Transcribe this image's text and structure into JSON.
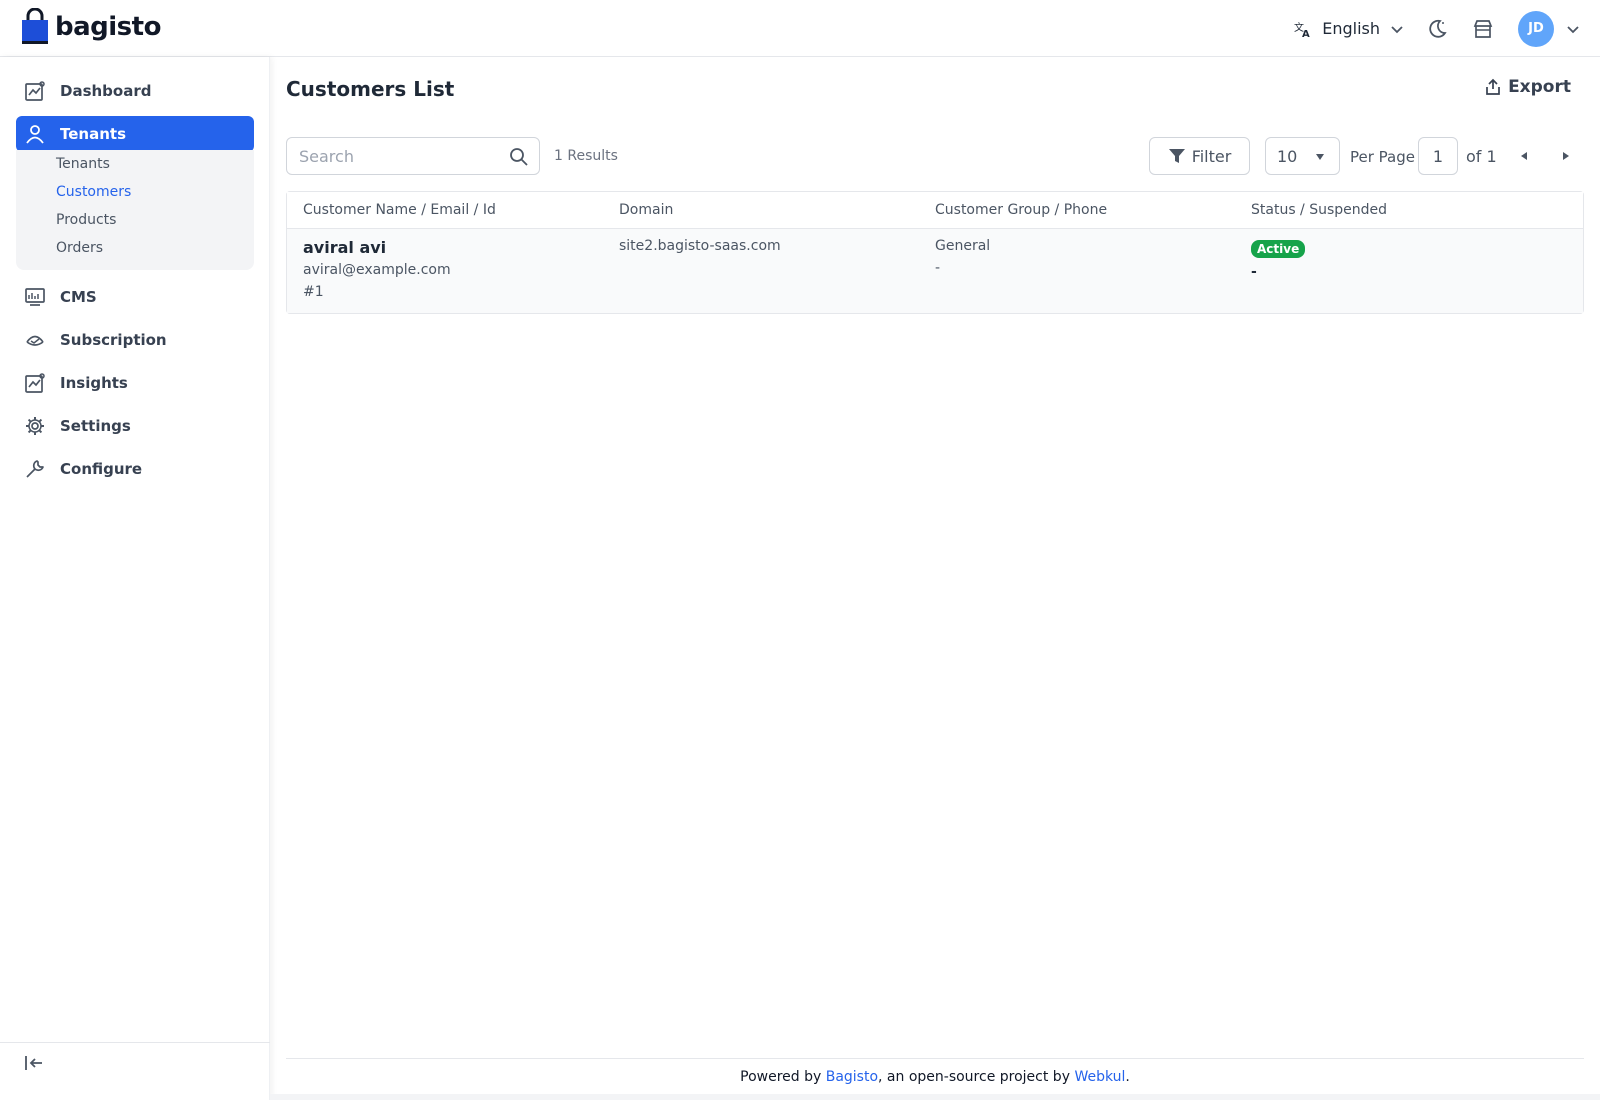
{
  "header": {
    "brand": "bagisto",
    "language": "English",
    "avatar_initials": "JD"
  },
  "sidebar": {
    "items": [
      {
        "label": "Dashboard",
        "icon": "dashboard-icon"
      },
      {
        "label": "Tenants",
        "icon": "user-icon",
        "active": true
      },
      {
        "label": "CMS",
        "icon": "cms-icon"
      },
      {
        "label": "Subscription",
        "icon": "subscription-icon"
      },
      {
        "label": "Insights",
        "icon": "insights-icon"
      },
      {
        "label": "Settings",
        "icon": "gear-icon"
      },
      {
        "label": "Configure",
        "icon": "wrench-icon"
      }
    ],
    "subitems": [
      {
        "label": "Tenants"
      },
      {
        "label": "Customers",
        "active": true
      },
      {
        "label": "Products"
      },
      {
        "label": "Orders"
      }
    ]
  },
  "main": {
    "title": "Customers List",
    "export_label": "Export",
    "search_placeholder": "Search",
    "results": "1 Results",
    "filter_label": "Filter",
    "per_page_value": "10",
    "per_page_label": "Per Page",
    "current_page": "1",
    "of_pages": "of 1",
    "columns": [
      "Customer Name / Email / Id",
      "Domain",
      "Customer Group / Phone",
      "Status / Suspended"
    ],
    "rows": [
      {
        "name": "aviral avi",
        "email": "aviral@example.com",
        "id": "#1",
        "domain": "site2.bagisto-saas.com",
        "group": "General",
        "phone": "-",
        "status": "Active",
        "suspended": "-"
      }
    ]
  },
  "footer": {
    "prefix": "Powered by ",
    "link1": "Bagisto",
    "middle": ", an open-source project by ",
    "link2": "Webkul",
    "suffix": "."
  },
  "colors": {
    "accent": "#2563eb",
    "active_badge": "#16a34a",
    "avatar": "#60a5fa"
  }
}
